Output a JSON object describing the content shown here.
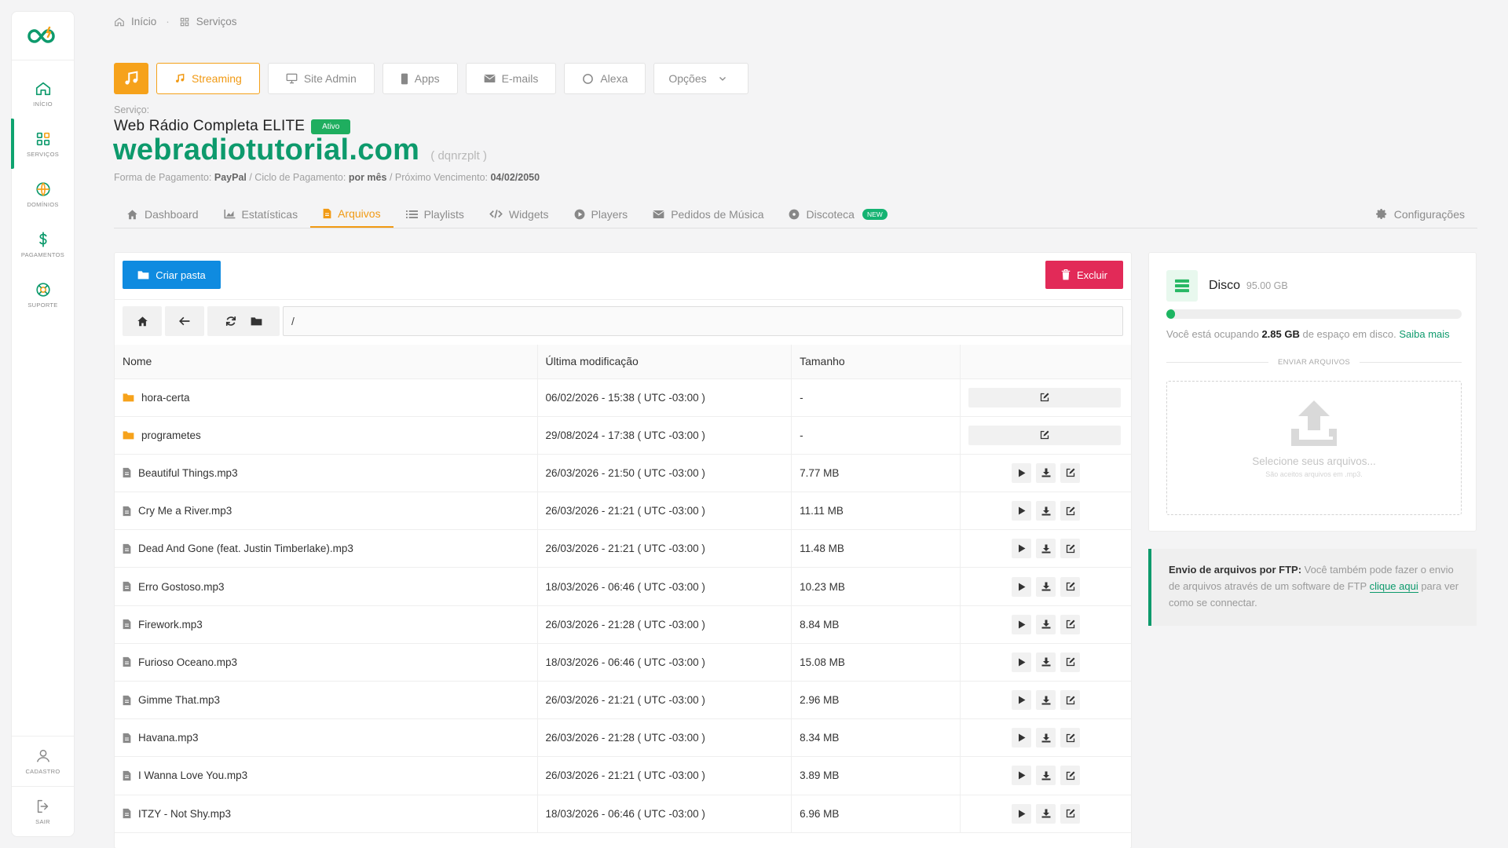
{
  "sidebar": {
    "items": [
      {
        "label": "INÍCIO",
        "icon": "home-icon"
      },
      {
        "label": "SERVIÇOS",
        "icon": "grid-icon"
      },
      {
        "label": "DOMÍNIOS",
        "icon": "globe-icon"
      },
      {
        "label": "PAGAMENTOS",
        "icon": "dollar-icon"
      },
      {
        "label": "SUPORTE",
        "icon": "lifebuoy-icon"
      }
    ],
    "bottom": [
      {
        "label": "CADASTRO",
        "icon": "user-icon"
      },
      {
        "label": "SAIR",
        "icon": "logout-icon"
      }
    ],
    "accent": "#0ea36f"
  },
  "breadcrumb": {
    "home": "Início",
    "current": "Serviços"
  },
  "topbar": {
    "buttons": [
      "Streaming",
      "Site Admin",
      "Apps",
      "E-mails",
      "Alexa",
      "Opções"
    ],
    "accent": "#f6a21b"
  },
  "service": {
    "kicker": "Serviço:",
    "plan": "Web Rádio Completa ELITE",
    "status": "Ativo",
    "domain": "webradiotutorial.com",
    "code": "( dqnrzplt )",
    "payment_label": "Forma de Pagamento:",
    "payment_value": "PayPal",
    "cycle_label": " / Ciclo de Pagamento:",
    "cycle_value": "por mês",
    "due_label": " / Próximo Vencimento:",
    "due_value": "04/02/2050"
  },
  "tabs": {
    "items": [
      "Dashboard",
      "Estatísticas",
      "Arquivos",
      "Playlists",
      "Widgets",
      "Players",
      "Pedidos de Música",
      "Discoteca"
    ],
    "new_badge": "NEW",
    "settings": "Configurações"
  },
  "filemanager": {
    "create_folder": "Criar pasta",
    "delete": "Excluir",
    "path": "/",
    "columns": [
      "Nome",
      "Última modificação",
      "Tamanho",
      ""
    ],
    "rows": [
      {
        "name": "hora-certa",
        "type": "folder",
        "modified": "06/02/2026 - 15:38 ( UTC -03:00 )",
        "size": "-"
      },
      {
        "name": "programetes",
        "type": "folder",
        "modified": "29/08/2024 - 17:38 ( UTC -03:00 )",
        "size": "-"
      },
      {
        "name": "Beautiful Things.mp3",
        "type": "file",
        "modified": "26/03/2026 - 21:50 ( UTC -03:00 )",
        "size": "7.77 MB"
      },
      {
        "name": "Cry Me a River.mp3",
        "type": "file",
        "modified": "26/03/2026 - 21:21 ( UTC -03:00 )",
        "size": "11.11 MB"
      },
      {
        "name": "Dead And Gone (feat. Justin Timberlake).mp3",
        "type": "file",
        "modified": "26/03/2026 - 21:21 ( UTC -03:00 )",
        "size": "11.48 MB"
      },
      {
        "name": "Erro Gostoso.mp3",
        "type": "file",
        "modified": "18/03/2026 - 06:46 ( UTC -03:00 )",
        "size": "10.23 MB"
      },
      {
        "name": "Firework.mp3",
        "type": "file",
        "modified": "26/03/2026 - 21:28 ( UTC -03:00 )",
        "size": "8.84 MB"
      },
      {
        "name": "Furioso Oceano.mp3",
        "type": "file",
        "modified": "18/03/2026 - 06:46 ( UTC -03:00 )",
        "size": "15.08 MB"
      },
      {
        "name": "Gimme That.mp3",
        "type": "file",
        "modified": "26/03/2026 - 21:21 ( UTC -03:00 )",
        "size": "2.96 MB"
      },
      {
        "name": "Havana.mp3",
        "type": "file",
        "modified": "26/03/2026 - 21:28 ( UTC -03:00 )",
        "size": "8.34 MB"
      },
      {
        "name": "I Wanna Love You.mp3",
        "type": "file",
        "modified": "26/03/2026 - 21:21 ( UTC -03:00 )",
        "size": "3.89 MB"
      },
      {
        "name": "ITZY - Not Shy.mp3",
        "type": "file",
        "modified": "18/03/2026 - 06:46 ( UTC -03:00 )",
        "size": "6.96 MB"
      }
    ]
  },
  "disk": {
    "title": "Disco",
    "capacity": "95.00 GB",
    "used_fraction": 0.03,
    "usage_prefix": "Você está ocupando ",
    "usage_value": "2.85 GB",
    "usage_suffix": " de espaço em disco. ",
    "more_link": "Saiba mais",
    "upload_label": "ENVIAR ARQUIVOS",
    "drop_text": "Selecione seus arquivos...",
    "drop_sub": "São aceitos arquivos em .mp3."
  },
  "ftp": {
    "title": "Envio de arquivos por FTP:",
    "text1": " Você também pode fazer o envio de arquivos através de um software de FTP ",
    "link": "clique aqui",
    "text2": " para ver como se connectar."
  }
}
